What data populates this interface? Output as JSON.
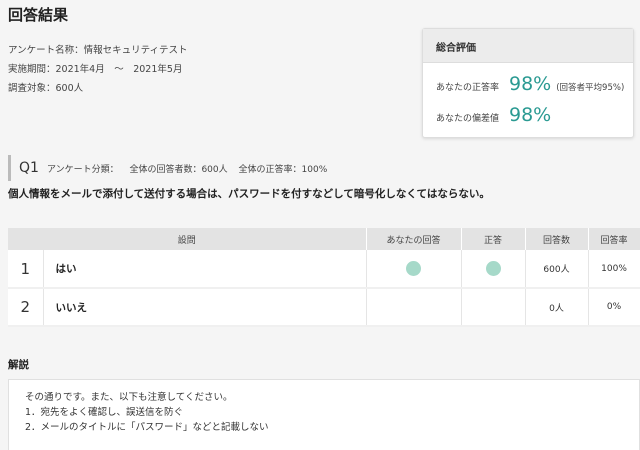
{
  "page": {
    "title": "回答結果"
  },
  "survey": {
    "name_line": "アンケート名称：情報セキュリティテスト",
    "period_line": "実施期間：2021年4月　～　2021年5月",
    "target_line": "調査対象：600人"
  },
  "summary": {
    "title": "総合評価",
    "correct_rate_label": "あなたの正答率",
    "correct_rate_value": "98%",
    "correct_rate_note": "(回答者平均95%)",
    "deviation_label": "あなたの偏差値",
    "deviation_value": "98%",
    "accent_color": "#2a9a92"
  },
  "question": {
    "number": "Q1",
    "category": "アンケート分類：",
    "respondents": "全体の回答者数：600人",
    "overall_rate": "全体の正答率：100%",
    "text": "個人情報をメールで添付して送付する場合は、パスワードを付すなどして暗号化しなくてはならない。"
  },
  "table": {
    "headers": [
      "設問",
      "あなたの回答",
      "正答",
      "回答数",
      "回答率"
    ],
    "rows": [
      {
        "index": "1",
        "choice": "はい",
        "your_answer": true,
        "correct": true,
        "count": "600人",
        "rate": "100%"
      },
      {
        "index": "2",
        "choice": "いいえ",
        "your_answer": false,
        "correct": false,
        "count": "0人",
        "rate": "0%"
      }
    ],
    "marker_color": "#a6d9c9"
  },
  "explanation": {
    "title": "解説",
    "lines": [
      "その通りです。また、以下も注意してください。",
      "1．宛先をよく確認し、誤送信を防ぐ",
      "2．メールのタイトルに「パスワード」などと記載しない"
    ]
  }
}
